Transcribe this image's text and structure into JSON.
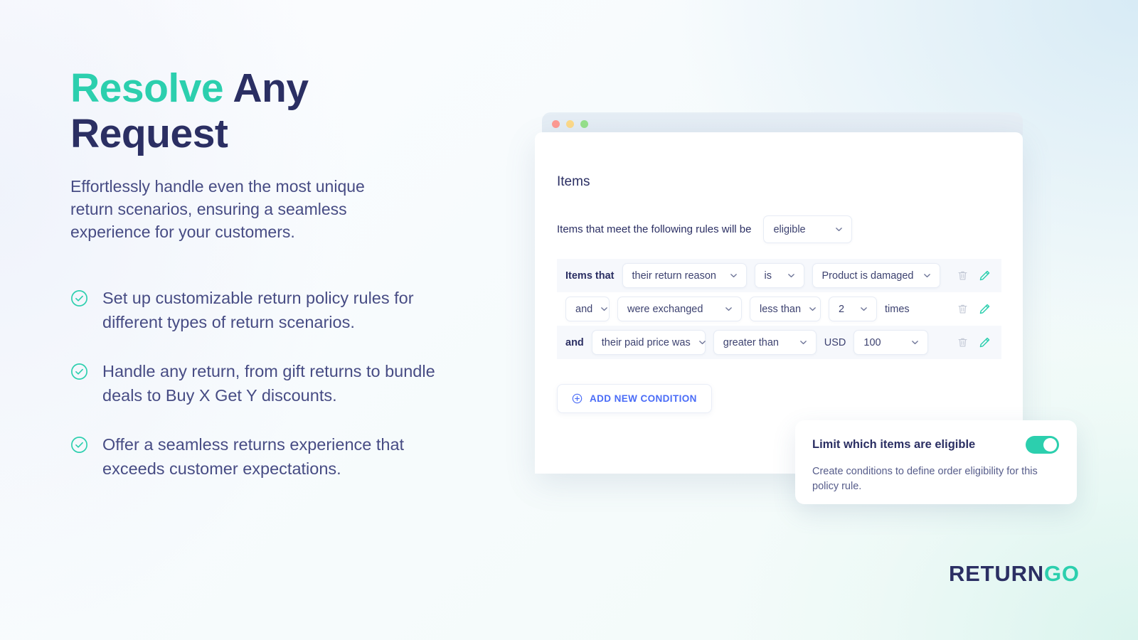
{
  "hero": {
    "headline_accent": "Resolve",
    "headline_rest": " Any Request",
    "subhead": "Effortlessly handle even the most unique return scenarios, ensuring a seamless experience for your customers.",
    "bullets": [
      "Set up customizable return policy rules for different types of return scenarios.",
      "Handle any return, from gift returns to bundle deals to Buy X Get Y discounts.",
      "Offer a seamless returns experience that exceeds customer expectations."
    ]
  },
  "app": {
    "titlebar_dots": [
      "red",
      "yellow",
      "green"
    ],
    "panel_title": "Items",
    "rules_label": "Items that meet the following rules will be",
    "eligibility_value": "eligible",
    "conditions": [
      {
        "lead": "Items that",
        "lead_is_select": false,
        "field": "their return reason",
        "operator": "is",
        "value": "Product is damaged",
        "unit_prefix": "",
        "unit_suffix": "",
        "delete_icon": "trash-icon",
        "edit_icon": "pencil-icon"
      },
      {
        "lead": "and",
        "lead_is_select": true,
        "field": "were exchanged",
        "operator": "less than",
        "value": "2",
        "unit_prefix": "",
        "unit_suffix": "times",
        "delete_icon": "trash-icon",
        "edit_icon": "pencil-icon"
      },
      {
        "lead": "and",
        "lead_is_select": false,
        "field": "their paid price was",
        "operator": "greater than",
        "value": "100",
        "unit_prefix": "USD",
        "unit_suffix": "",
        "delete_icon": "trash-icon",
        "edit_icon": "pencil-icon"
      }
    ],
    "add_condition_label": "ADD NEW CONDITION",
    "add_condition_icon": "plus-circle-icon"
  },
  "float_card": {
    "title": "Limit which items are eligible",
    "description": "Create conditions to define order eligibility for this policy rule.",
    "toggle_on": true
  },
  "brand": {
    "name_dark": "RETURN",
    "name_accent": "GO"
  },
  "colors": {
    "accent_teal": "#2ccfae",
    "navy": "#2b2f63",
    "body_text": "#474c84",
    "link_blue": "#4a6cf7",
    "row_shade": "#f6f8fc"
  }
}
